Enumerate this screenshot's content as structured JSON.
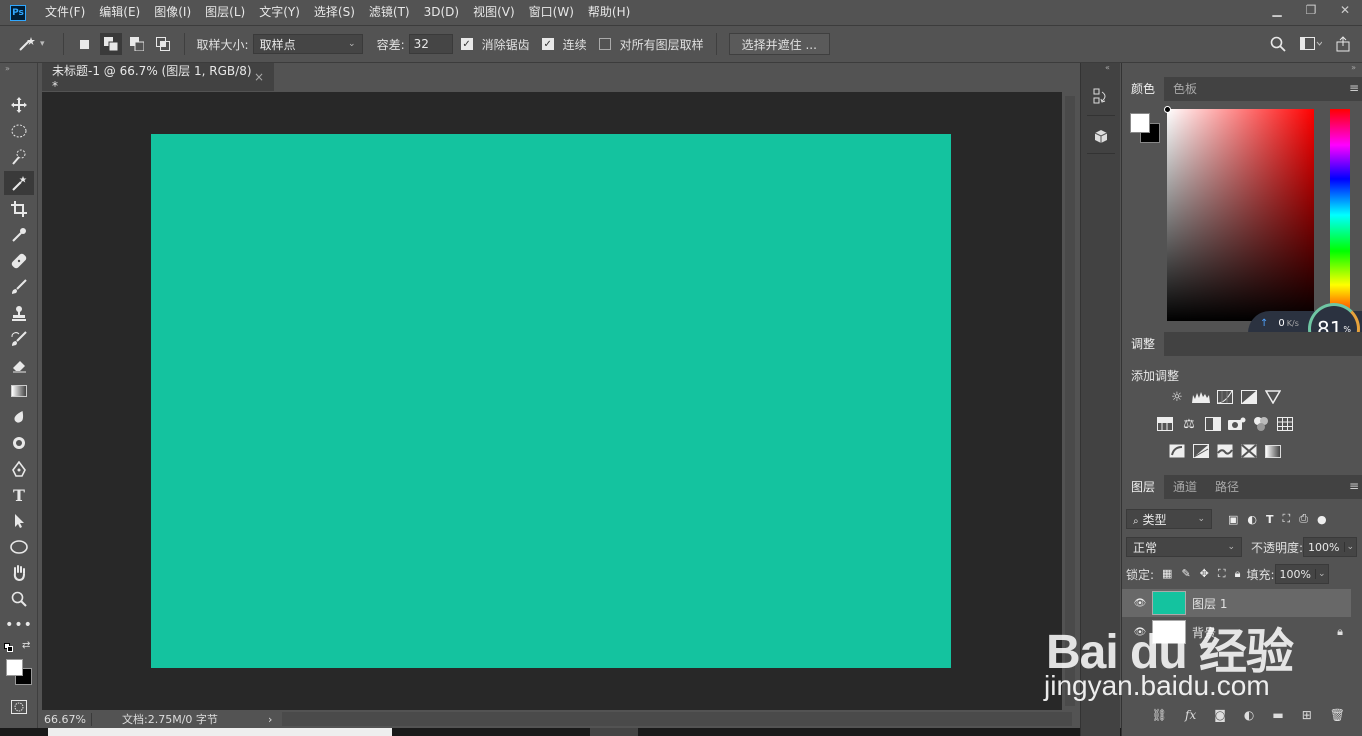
{
  "app": {
    "logo": "Ps"
  },
  "menu": [
    "文件(F)",
    "编辑(E)",
    "图像(I)",
    "图层(L)",
    "文字(Y)",
    "选择(S)",
    "滤镜(T)",
    "3D(D)",
    "视图(V)",
    "窗口(W)",
    "帮助(H)"
  ],
  "window_controls": {
    "minimize": "▁",
    "restore": "❐",
    "close": "✕"
  },
  "options": {
    "sample_size_label": "取样大小:",
    "sample_size_value": "取样点",
    "tolerance_label": "容差:",
    "tolerance_value": "32",
    "antialias_label": "消除锯齿",
    "antialias_checked": true,
    "contiguous_label": "连续",
    "contiguous_checked": true,
    "sample_all_layers_label": "对所有图层取样",
    "sample_all_layers_checked": false,
    "select_mask_button": "选择并遮住 ..."
  },
  "document": {
    "tab_title": "未标题-1 @ 66.7% (图层 1, RGB/8) *",
    "close": "×",
    "canvas_color": "#14c39f",
    "zoom": "66.67%",
    "doc_info": "文档:2.75M/0 字节",
    "status_arrow": "›"
  },
  "tools": [
    "move-tool",
    "elliptical-marquee-tool",
    "quick-selection-tool",
    "magic-wand-tool",
    "crop-tool",
    "eyedropper-tool",
    "healing-brush-tool",
    "brush-tool",
    "clone-stamp-tool",
    "history-brush-tool",
    "eraser-tool",
    "gradient-tool",
    "blur-tool",
    "dodge-tool",
    "pen-tool",
    "type-tool",
    "path-selection-tool",
    "ellipse-tool",
    "hand-tool",
    "zoom-tool",
    "more-tools"
  ],
  "color_panel": {
    "tabs": [
      "颜色",
      "色板"
    ],
    "fg": "#ffffff",
    "bg": "#000000"
  },
  "net_widget": {
    "upload": "0",
    "download": "0",
    "unit": "K/s",
    "gauge": "81",
    "gauge_unit": "%"
  },
  "adjustments_panel": {
    "tab": "调整",
    "title": "添加调整"
  },
  "layers_panel": {
    "tabs": [
      "图层",
      "通道",
      "路径"
    ],
    "filter_label": "类型",
    "blend_mode": "正常",
    "opacity_label": "不透明度:",
    "opacity_value": "100%",
    "lock_label": "锁定:",
    "fill_label": "填充:",
    "fill_value": "100%",
    "layers": [
      {
        "name": "图层 1",
        "thumb_color": "#14c39f",
        "selected": true
      },
      {
        "name": "背景",
        "thumb_color": "#ffffff",
        "selected": false,
        "locked": true
      }
    ]
  },
  "watermark": {
    "logo": "Bai du 经验",
    "url": "jingyan.baidu.com"
  }
}
